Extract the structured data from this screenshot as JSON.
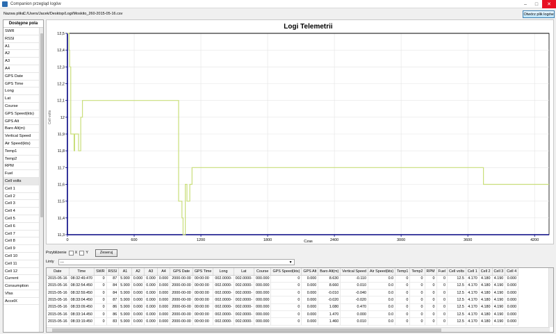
{
  "window": {
    "title": "Companion przegląd logów",
    "controls": [
      "–",
      "□",
      "✕"
    ]
  },
  "path_row": {
    "label": "Nazwa pliku",
    "path": "C:/Users/Jacek/Desktop/Logi/Moskito_260-2015-05-16.csv",
    "open_button": "Otwórz plik logów"
  },
  "sidebar": {
    "header": "Dostępne pola",
    "items": [
      "SWR",
      "RSSI",
      "A1",
      "A2",
      "A3",
      "A4",
      "GPS Date",
      "GPS Time",
      "Long",
      "Lat",
      "Course",
      "GPS Speed(kts)",
      "GPS Alt",
      "Baro Alt(m)",
      "Vertical Speed",
      "Air Speed(kts)",
      "Temp1",
      "Temp2",
      "RPM",
      "Fuel",
      "Cell volts",
      "Cell 1",
      "Cell 2",
      "Cell 3",
      "Cell 4",
      "Cell 5",
      "Cell 6",
      "Cell 7",
      "Cell 8",
      "Cell 9",
      "Cell 10",
      "Cell 11",
      "Cell 12",
      "Current",
      "Consumption",
      "Vfas",
      "AccelX"
    ],
    "selected": "Cell volts"
  },
  "chart_data": {
    "type": "line",
    "title": "Logi Telemetrii",
    "xlabel": "Czas",
    "ylabel": "Cell volts",
    "xlim": [
      0,
      4330
    ],
    "ylim": [
      11.3,
      12.5
    ],
    "xticks": [
      0,
      600,
      1200,
      1800,
      2400,
      3000,
      3600,
      4200
    ],
    "yticks": [
      11.3,
      11.4,
      11.5,
      11.6,
      11.7,
      11.8,
      11.9,
      12.0,
      12.1,
      12.2,
      12.3,
      12.4,
      12.5
    ],
    "ytick_labels": [
      "11,3",
      "11,4",
      "11,5",
      "11,6",
      "11,7",
      "11,8",
      "11,9",
      "12",
      "12,1",
      "12,2",
      "12,3",
      "12,4",
      "12,5"
    ],
    "grid": true,
    "series": [
      {
        "color": "#c9de7a",
        "x": [
          0,
          15,
          15,
          20,
          20,
          30,
          30,
          60,
          60,
          65,
          65,
          100,
          100,
          120,
          120,
          135,
          135,
          155,
          155,
          1000,
          1000,
          1030,
          1030,
          1040,
          1040,
          1060,
          1060,
          1075,
          1075,
          1100,
          1100,
          1120,
          1120,
          3740,
          3740,
          4330
        ],
        "y": [
          12.5,
          12.5,
          12.4,
          12.4,
          12.3,
          12.3,
          11.9,
          11.9,
          11.8,
          11.8,
          11.9,
          11.9,
          11.8,
          11.8,
          12.0,
          12.0,
          12.1,
          12.1,
          12.1,
          12.1,
          11.5,
          11.5,
          11.4,
          11.4,
          11.3,
          11.3,
          11.6,
          11.6,
          11.5,
          11.5,
          11.6,
          11.6,
          11.7,
          11.7,
          11.6,
          11.6
        ]
      }
    ],
    "colors": {
      "axis": "#000080",
      "frame": "#000000",
      "grid": "#e4e4e4"
    }
  },
  "zoom": {
    "label": "Przybliżenie",
    "x_label": "X",
    "y_label": "Y",
    "reset_button": "Zeseruj"
  },
  "lines": {
    "label": "Linty",
    "value": "---"
  },
  "table": {
    "columns": [
      "Date",
      "Time",
      "SWR",
      "RSSI",
      "A1",
      "A2",
      "A3",
      "A4",
      "GPS Date",
      "GPS Time",
      "Long",
      "Lat",
      "Course",
      "GPS Speed(kts)",
      "GPS Alt",
      "Baro Alt(m)",
      "Vertical Speed",
      "Air Speed(kts)",
      "Temp1",
      "Temp2",
      "RPM",
      "Fuel",
      "Cell volts",
      "Cell 1",
      "Cell 2",
      "Cell 3",
      "Cell 4"
    ],
    "rows": [
      [
        "2015-05-16",
        "08:32:49.470",
        "0",
        "87",
        "5.900",
        "0.000",
        "0.000",
        "0.000",
        "2000-00-00",
        "00:00:00",
        "002.0000-",
        "002.0000-",
        "000.000",
        "0",
        "0.000",
        "8.630",
        "-0.110",
        "0.0",
        "0",
        "0",
        "0",
        "0",
        "12.5",
        "4.170",
        "4.180",
        "4.190",
        "0.000"
      ],
      [
        "2015-05-16",
        "08:32:54.450",
        "0",
        "84",
        "5.900",
        "0.000",
        "0.000",
        "0.000",
        "2000-00-00",
        "00:00:00",
        "002.0000-",
        "002.0000-",
        "000.000",
        "0",
        "0.000",
        "8.660",
        "0.010",
        "0.0",
        "0",
        "0",
        "0",
        "0",
        "12.5",
        "4.170",
        "4.180",
        "4.190",
        "0.000"
      ],
      [
        "2015-05-16",
        "08:32:59.450",
        "0",
        "84",
        "5.900",
        "0.000",
        "0.000",
        "0.000",
        "2000-00-00",
        "00:00:00",
        "002.0000-",
        "002.0000-",
        "000.000",
        "0",
        "0.000",
        "-0.010",
        "-0.040",
        "0.0",
        "0",
        "0",
        "0",
        "0",
        "12.5",
        "4.170",
        "4.180",
        "4.190",
        "0.000"
      ],
      [
        "2015-05-16",
        "08:33:04.450",
        "0",
        "87",
        "5.900",
        "0.000",
        "0.000",
        "0.000",
        "2000-00-00",
        "00:00:00",
        "002.0000-",
        "002.0000-",
        "000.000",
        "0",
        "0.000",
        "-0.020",
        "-0.020",
        "0.0",
        "0",
        "0",
        "0",
        "0",
        "12.5",
        "4.170",
        "4.180",
        "4.190",
        "0.000"
      ],
      [
        "2015-05-16",
        "08:33:09.450",
        "0",
        "86",
        "5.900",
        "0.000",
        "0.000",
        "0.000",
        "2000-00-00",
        "00:00:00",
        "002.0000-",
        "002.0000-",
        "000.000",
        "0",
        "0.000",
        "1.080",
        "0.470",
        "0.0",
        "0",
        "0",
        "0",
        "0",
        "12.5",
        "4.170",
        "4.180",
        "4.190",
        "0.000"
      ],
      [
        "2015-05-16",
        "08:33:14.450",
        "0",
        "86",
        "5.900",
        "0.000",
        "0.000",
        "0.000",
        "2000-00-00",
        "00:00:00",
        "002.0000-",
        "002.0000-",
        "000.000",
        "0",
        "0.000",
        "1.470",
        "0.000",
        "0.0",
        "0",
        "0",
        "0",
        "0",
        "12.5",
        "4.170",
        "4.180",
        "4.190",
        "0.000"
      ],
      [
        "2015-05-16",
        "08:33:19.450",
        "0",
        "83",
        "5.900",
        "0.000",
        "0.000",
        "0.000",
        "2000-00-00",
        "00:00:00",
        "002.0000-",
        "002.0000-",
        "000.000",
        "0",
        "0.000",
        "1.460",
        "0.010",
        "0.0",
        "0",
        "0",
        "0",
        "0",
        "12.5",
        "4.170",
        "4.180",
        "4.190",
        "0.000"
      ]
    ]
  }
}
